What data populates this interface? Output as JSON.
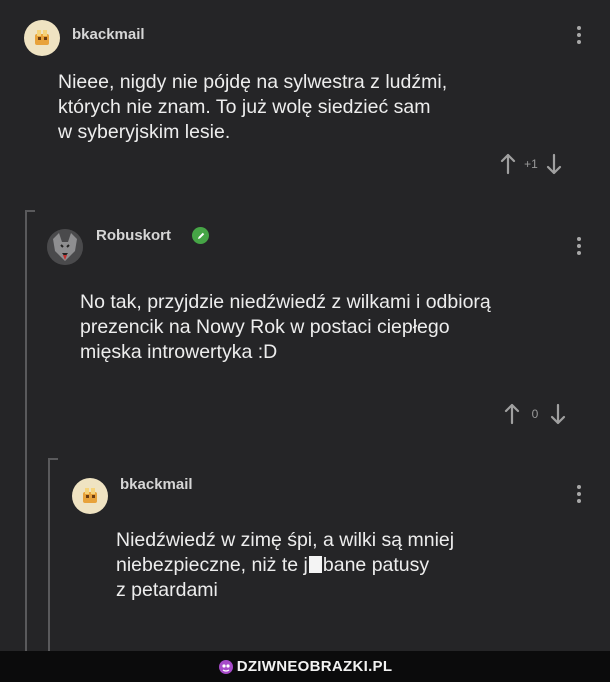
{
  "comments": [
    {
      "username": "bkackmail",
      "lines": [
        "Nieee, nigdy nie pójdę na sylwestra z ludźmi,",
        "których nie znam. To już wolę siedzieć sam",
        "w syberyjskim lesie."
      ],
      "vote_count": "+1"
    },
    {
      "username": "Robuskort",
      "lines": [
        "No tak, przyjdzie niedźwiedź z wilkami i odbiorą",
        "prezencik na Nowy Rok w postaci ciepłego",
        "mięska introwertyka :D"
      ],
      "vote_count": "0"
    },
    {
      "username": "bkackmail",
      "lines": [
        "Niedźwiedź w zimę śpi, a wilki są mniej",
        "niebezpieczne, niż te ",
        "bane patusy",
        "z petardami"
      ],
      "censored_prefix": "j"
    }
  ],
  "footer": {
    "brand": "DZIWNEOBRAZKI.PL"
  },
  "icons": [
    "kebab-menu-icon",
    "upvote-arrow-icon",
    "downvote-arrow-icon",
    "verified-pencil-icon",
    "brand-logo-icon"
  ]
}
